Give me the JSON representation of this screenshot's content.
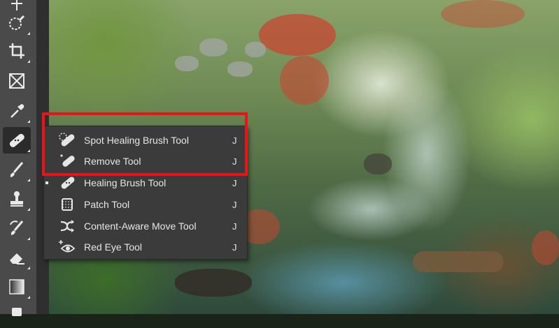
{
  "toolbar": {
    "tools": [
      {
        "name": "lasso-tool",
        "icon": "lasso-brush-icon"
      },
      {
        "name": "crop-tool",
        "icon": "crop-icon"
      },
      {
        "name": "frame-tool",
        "icon": "frame-icon"
      },
      {
        "name": "eyedropper-tool",
        "icon": "eyedropper-icon"
      },
      {
        "name": "healing-tool",
        "icon": "bandage-icon",
        "active": true
      },
      {
        "name": "brush-tool",
        "icon": "brush-icon"
      },
      {
        "name": "clone-stamp-tool",
        "icon": "stamp-icon"
      },
      {
        "name": "history-brush-tool",
        "icon": "history-brush-icon"
      },
      {
        "name": "eraser-tool",
        "icon": "eraser-icon"
      },
      {
        "name": "gradient-tool",
        "icon": "gradient-icon"
      }
    ]
  },
  "flyout": {
    "items": [
      {
        "label": "Spot Healing Brush Tool",
        "shortcut": "J",
        "icon": "spot-healing-icon"
      },
      {
        "label": "Remove Tool",
        "shortcut": "J",
        "icon": "remove-tool-icon"
      },
      {
        "label": "Healing Brush Tool",
        "shortcut": "J",
        "icon": "healing-brush-icon",
        "selected": true
      },
      {
        "label": "Patch Tool",
        "shortcut": "J",
        "icon": "patch-icon"
      },
      {
        "label": "Content-Aware Move Tool",
        "shortcut": "J",
        "icon": "content-aware-move-icon"
      },
      {
        "label": "Red Eye Tool",
        "shortcut": "J",
        "icon": "red-eye-icon"
      }
    ]
  },
  "colors": {
    "highlight": "#e8141a",
    "menu_bg": "#3b3b3b",
    "toolbar_bg": "#4a4a4a"
  }
}
